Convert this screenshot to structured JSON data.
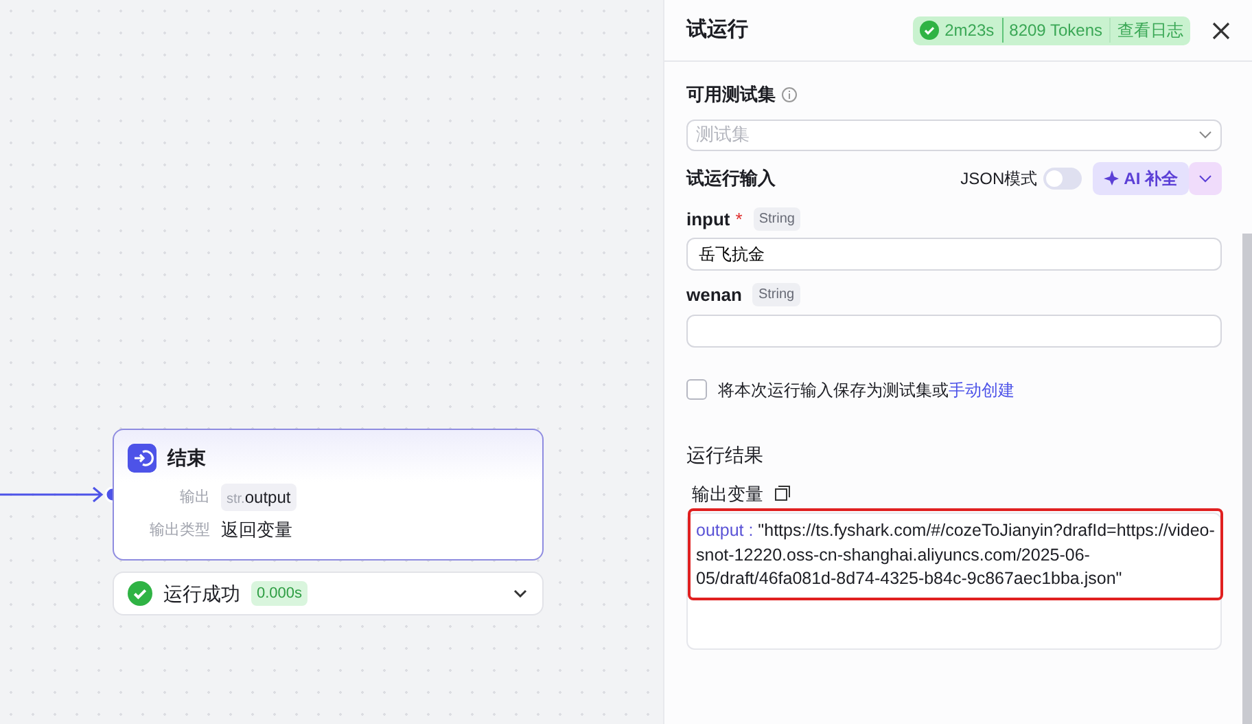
{
  "canvas": {
    "node": {
      "title": "结束",
      "rows": [
        {
          "kind": "tag",
          "label": "输出",
          "tag_prefix": "str.",
          "value": "output"
        },
        {
          "kind": "text",
          "label": "输出类型",
          "value": "返回变量"
        }
      ]
    },
    "run_status": {
      "success": true,
      "label": "运行成功",
      "time": "0.000s",
      "expanded": false
    }
  },
  "panel": {
    "title": "试运行",
    "summary": {
      "success": true,
      "duration": "2m23s",
      "tokens": "8209 Tokens",
      "log_link": "查看日志"
    },
    "testset": {
      "label": "可用测试集",
      "placeholder": "测试集"
    },
    "inputs": {
      "title": "试运行输入",
      "required_mark": "*",
      "json_mode": {
        "label": "JSON模式",
        "on": false
      },
      "ai_button": "AI 补全",
      "fields": [
        {
          "name": "input",
          "required": true,
          "type": "String",
          "value": "岳飞抗金"
        },
        {
          "name": "wenan",
          "required": false,
          "type": "String"
        }
      ]
    },
    "save": {
      "checked": false,
      "text": "将本次运行输入保存为测试集或",
      "link": "手动创建"
    },
    "results": {
      "title": "运行结果",
      "output_label": "输出变量",
      "output": {
        "key": "output",
        "separator": ":",
        "value": "\"https://ts.fyshark.com/#/cozeToJianyin?drafId=https://video-snot-12220.oss-cn-shanghai.aliyuncs.com/2025-06-05/draft/46fa081d-8d74-4325-b84c-9c867aec1bba.json\"",
        "highlighted": true
      }
    }
  }
}
